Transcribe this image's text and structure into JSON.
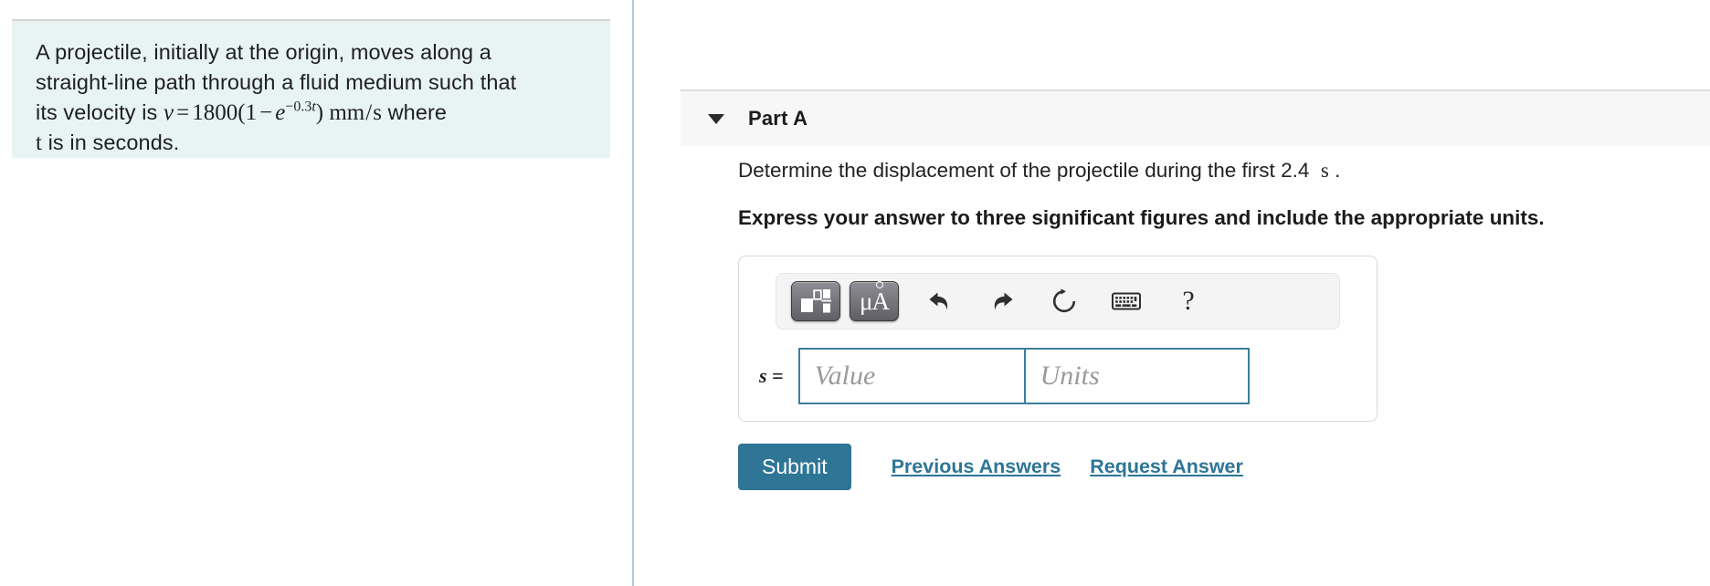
{
  "problem": {
    "line1": "A projectile, initially at the origin, moves along a",
    "line2": "straight-line path through a fluid medium such that",
    "line3_prefix": "its velocity is ",
    "equation": {
      "lhs": "v",
      "eq": "=",
      "coefficient": "1800",
      "paren_open": "(",
      "one": "1",
      "minus": "−",
      "exp_base": "e",
      "exp_sign": "−",
      "exp_coefficient": "0.3",
      "exp_var": "t",
      "paren_close": ")",
      "units_numerator": "mm",
      "units_slash": "/",
      "units_denominator": "s",
      "plain": "v = 1800(1 − e^{-0.3t}) mm/s"
    },
    "line3_suffix": " where",
    "line4_var": "t",
    "line4_text": " is in seconds.",
    "background_color": "#e7f4f3"
  },
  "part": {
    "caret_icon": "caret-down-icon",
    "title": "Part A",
    "header_background": "#f7f7f7",
    "question_prefix": "Determine the displacement of the projectile during the first ",
    "question_value": "2.4",
    "question_unit": "s",
    "question_suffix": ".",
    "instruction": "Express your answer to three significant figures and include the appropriate units."
  },
  "answer": {
    "toolbar": {
      "template_button": {
        "icon": "math-template-icon",
        "title": "Math templates"
      },
      "units_button": {
        "icon": "units-icon",
        "label_mu": "μ",
        "label_angstrom": "A",
        "title": "Units"
      },
      "undo_button": {
        "icon": "undo-icon",
        "title": "Undo"
      },
      "redo_button": {
        "icon": "redo-icon",
        "title": "Redo"
      },
      "reset_button": {
        "icon": "reset-icon",
        "title": "Reset"
      },
      "keyboard_button": {
        "icon": "keyboard-icon",
        "title": "Keyboard shortcuts"
      },
      "help_button": {
        "icon": "question-mark-icon",
        "label": "?",
        "title": "Help"
      }
    },
    "variable_label": "s",
    "equals_sign": "=",
    "value_input": {
      "value": "",
      "placeholder": "Value"
    },
    "units_input": {
      "value": "",
      "placeholder": "Units"
    },
    "border_color": "#3a7f9b"
  },
  "actions": {
    "submit_label": "Submit",
    "previous_answers_label": "Previous Answers",
    "request_answer_label": "Request Answer",
    "accent_color": "#2e7596"
  }
}
